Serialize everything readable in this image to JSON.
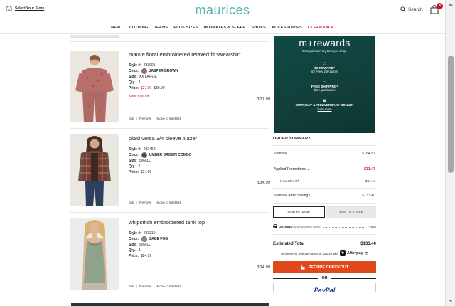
{
  "header": {
    "store_label": "Select Your Store",
    "logo": "maurices",
    "search_label": "Search",
    "bag_count": "4",
    "nav": [
      "NEW",
      "CLOTHING",
      "JEANS",
      "PLUS SIZES",
      "INTIMATES & SLEEP",
      "SHOES",
      "ACCESSORIES",
      "CLEARANCE"
    ]
  },
  "cart": {
    "items": [
      {
        "name": "mauve floral embroidered relaxed fit sweatshirt",
        "style_label": "Style #:",
        "style": "233905",
        "color_label": "Color:",
        "color": "JASPER BROWN",
        "swatch": "#b5665f",
        "size_label": "Size:",
        "size": "XX LARGE",
        "qty_label": "Qty.:",
        "qty": "1",
        "price_label": "Price:",
        "price_now": "$27.99",
        "price_was": "$39.99",
        "promo": "Now 30% Off",
        "line_total": "$27.99",
        "actions": [
          "Edit",
          "Remove",
          "Move to Wishlist"
        ]
      },
      {
        "name": "plaid versa 3/4 sleeve blazer",
        "style_label": "Style #:",
        "style": "232450",
        "color_label": "Color:",
        "color": "UMBER BROWN COMBO",
        "swatch": "#5a4436",
        "size_label": "Size:",
        "size": "SMALL",
        "qty_label": "Qty.:",
        "qty": "1",
        "price_label": "Price:",
        "price": "$34.99",
        "line_total": "$34.99",
        "actions": [
          "Edit",
          "Remove",
          "Move to Wishlist"
        ]
      },
      {
        "name": "whipstitch embroidered tank top",
        "style_label": "Style #:",
        "style": "233319",
        "color_label": "Color:",
        "color": "SAGE FOG",
        "swatch": "#7f937c",
        "size_label": "Size:",
        "size": "SMALL",
        "qty_label": "Qty.:",
        "qty": "1",
        "price_label": "Price:",
        "price": "$24.99",
        "line_total": "$24.99",
        "actions": [
          "Edit",
          "Remove",
          "Move to Wishlist"
        ]
      }
    ]
  },
  "rewards": {
    "title": "m+rewards",
    "subtitle": "Earn points every time you shop.",
    "b1_head": "$5 REWARD*",
    "b1_small": "for every 100 points",
    "b2_head": "FREE SHIPPING*",
    "b2_small": "$50+ purchases",
    "b3_head": "BIRTHDAY & ANNIVERSARY BONUS*",
    "learn": "learn more"
  },
  "summary": {
    "title": "ORDER SUMMARY",
    "subtotal_label": "Subtotal",
    "subtotal": "$164.87",
    "promo_label": "Applied Promotions",
    "promo_total": "-$31.47",
    "promo_item_label": "Now 30% Off",
    "promo_item": "-$31.47",
    "after_label": "Subtotal After Savings",
    "after": "$133.40",
    "tab_home": "SHIP TO HOME",
    "tab_store": "SHIP TO STORE",
    "ship_label": "GROUND",
    "ship_days": "(5-8 business Days)",
    "ship_price": "FREE",
    "est_label": "Estimated Total",
    "est": "$133.40",
    "afterpay_text": "or 4 interest free payments of $33.35 with",
    "afterpay_brand": "Afterpay",
    "checkout": "SECURE CHECKOUT",
    "or": "OR",
    "paypal": "PayPal"
  },
  "colors": {
    "brand_teal": "#52b2ac",
    "clearance_red": "#c8102e",
    "checkout_orange": "#e0491b",
    "rewards_green": "#0f4a45"
  }
}
